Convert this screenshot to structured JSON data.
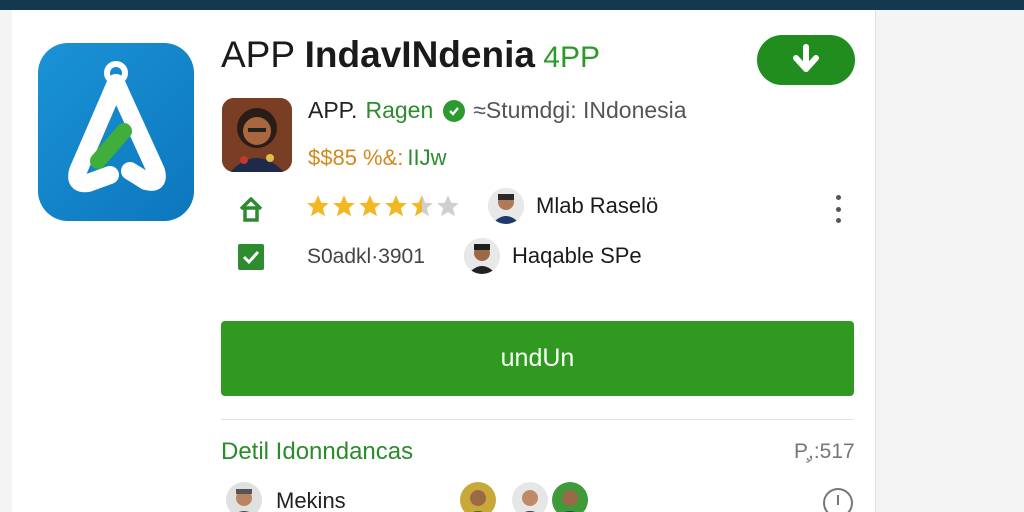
{
  "app": {
    "title_prefix": "APP ",
    "title_main": "IndavINdenia",
    "title_suffix": " 4PP",
    "icon": "app-logo-icon",
    "developer_prefix": "APP.",
    "developer": "Ragen",
    "location": "≈Stumdgi: INdonesia",
    "price": "$$85 %&:",
    "size": "IIJw",
    "rating": 4.5,
    "rating_max": 5,
    "stat": "S0adkl·3901"
  },
  "people": [
    {
      "name": "Mlab Raselö"
    },
    {
      "name": "Haqable SPe"
    }
  ],
  "actions": {
    "download_icon": "download-icon",
    "download_label": "undUn",
    "more_icon": "kebab-menu-icon"
  },
  "details": {
    "title": "Detil Idonndancas",
    "count": "P̧,:517",
    "reviewer": "Mekins"
  },
  "colors": {
    "brand_green": "#2f9a1f",
    "link_green": "#2e8b2e",
    "icon_blue": "#1a93d6",
    "star": "#f2b824",
    "top_bar": "#14394f"
  }
}
